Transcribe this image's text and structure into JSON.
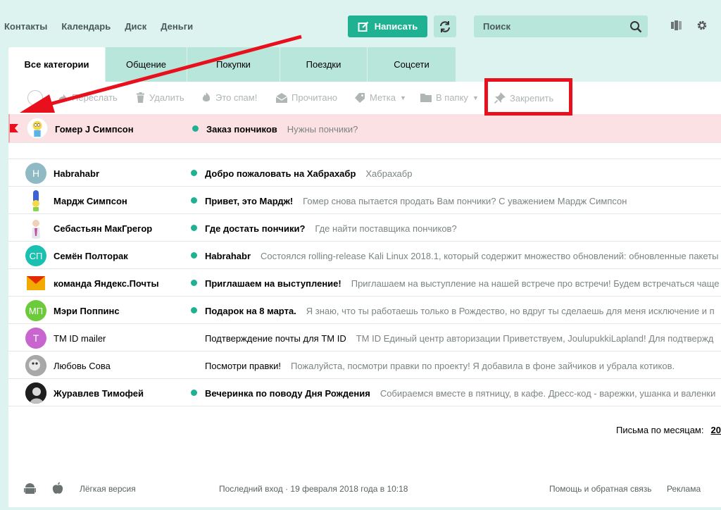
{
  "topnav": [
    "Контакты",
    "Календарь",
    "Диск",
    "Деньги"
  ],
  "compose": {
    "label": "Написать"
  },
  "search": {
    "placeholder": "Поиск"
  },
  "tabs": [
    {
      "label": "Все категории",
      "active": true
    },
    {
      "label": "Общение"
    },
    {
      "label": "Покупки"
    },
    {
      "label": "Поездки"
    },
    {
      "label": "Соцсети"
    }
  ],
  "toolbar": {
    "forward": "Переслать",
    "delete": "Удалить",
    "spam": "Это спам!",
    "read": "Прочитано",
    "label": "Метка",
    "folder": "В папку",
    "pin": "Закрепить"
  },
  "pinned": {
    "sender": "Гомер J Симпсон",
    "subject": "Заказ пончиков",
    "snippet": "Нужны пончики?"
  },
  "messages": [
    {
      "sender": "Habrahabr",
      "avatar_letter": "H",
      "avatar_color": "#8fb9c4",
      "unread": true,
      "subject": "Добро пожаловать на Хабрахабр",
      "snippet": "Хабрахабр"
    },
    {
      "sender": "Мардж Симпсон",
      "avatar_letter": "",
      "unread": true,
      "subject": "Привет, это Мардж!",
      "snippet": "Гомер снова пытается продать Вам пончики? С уважением Мардж Симпсон"
    },
    {
      "sender": "Себастьян МакГрегор",
      "avatar_letter": "",
      "unread": true,
      "subject": "Где достать пончики?",
      "snippet": "Где найти поставщика пончиков?"
    },
    {
      "sender": "Семён Полторак",
      "avatar_letter": "СП",
      "avatar_color": "#1bc1b0",
      "unread": true,
      "subject": "Habrahabr",
      "snippet": "Состоялся rolling-release Kali Linux 2018.1, который содержит множество обновлений: обновленные пакеты"
    },
    {
      "sender": "команда Яндекс.Почты",
      "avatar_letter": "",
      "unread": true,
      "subject": "Приглашаем на выступление!",
      "snippet": "Приглашаем на выступление на нашей встрече про встречи! Будем встречаться чаще"
    },
    {
      "sender": "Мэри Поппинс",
      "avatar_letter": "МП",
      "avatar_color": "#6ccb3b",
      "unread": true,
      "subject": "Подарок на 8 марта.",
      "snippet": "Я знаю, что ты работаешь только в Рождество, но вдруг ты сделаешь для меня исключение и п"
    },
    {
      "sender": "TM ID mailer",
      "avatar_letter": "T",
      "avatar_color": "#c865cf",
      "unread": false,
      "subject": "Подтверждение почты для TM ID",
      "snippet": "TM ID Единый центр авторизации Приветствуем, JoulupukkiLapland! Для подтвержд"
    },
    {
      "sender": "Любовь Сова",
      "avatar_letter": "",
      "unread": false,
      "subject": "Посмотри правки!",
      "snippet": "Пожалуйста, посмотри правки по проекту! Я добавила в фоне зайчиков и убрала котиков."
    },
    {
      "sender": "Журавлев Тимофей",
      "avatar_letter": "",
      "unread": true,
      "subject": "Вечеринка по поводу Дня Рождения",
      "snippet": "Собираемся вместе в пятницу, в кафе. Дресс-код - варежки, ушанка и валенки"
    }
  ],
  "months": {
    "label": "Письма по месяцам:",
    "year": "20"
  },
  "footer": {
    "light": "Лёгкая версия",
    "last_login": "Последний вход · 19 февраля 2018 года в 10:18",
    "help": "Помощь и обратная связь",
    "ads": "Реклама"
  },
  "colors": {
    "accent": "#1fb292",
    "annotation": "#e8101c"
  }
}
